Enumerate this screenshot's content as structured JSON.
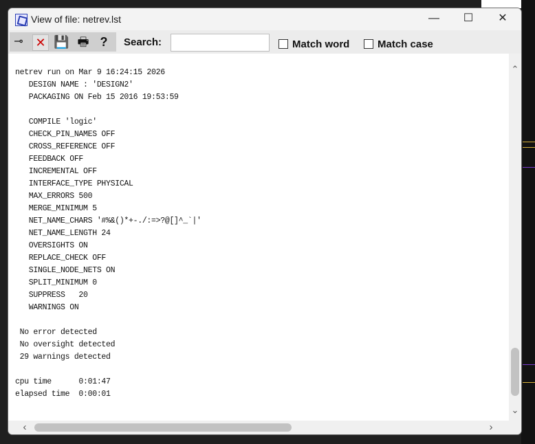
{
  "window": {
    "title": "View of file: netrev.lst",
    "controls": {
      "minimize": "—",
      "maximize": "☐",
      "close": "✕"
    }
  },
  "toolbar": {
    "tools": [
      {
        "name": "pin-tool",
        "glyph": "⊸"
      },
      {
        "name": "cancel-tool",
        "glyph": "✕"
      },
      {
        "name": "save-tool",
        "glyph": "💾"
      },
      {
        "name": "print-tool",
        "glyph": "🖶"
      },
      {
        "name": "help-tool",
        "glyph": "?"
      }
    ],
    "search_label": "Search:",
    "search_value": "",
    "match_word_label": "Match word",
    "match_word_checked": false,
    "match_case_label": "Match case",
    "match_case_checked": false
  },
  "file": {
    "lines": [
      "netrev run on Mar 9 16:24:15 2026",
      "   DESIGN NAME : 'DESIGN2'",
      "   PACKAGING ON Feb 15 2016 19:53:59",
      "",
      "   COMPILE 'logic'",
      "   CHECK_PIN_NAMES OFF",
      "   CROSS_REFERENCE OFF",
      "   FEEDBACK OFF",
      "   INCREMENTAL OFF",
      "   INTERFACE_TYPE PHYSICAL",
      "   MAX_ERRORS 500",
      "   MERGE_MINIMUM 5",
      "   NET_NAME_CHARS '#%&()*+-./:=>?@[]^_`|'",
      "   NET_NAME_LENGTH 24",
      "   OVERSIGHTS ON",
      "   REPLACE_CHECK OFF",
      "   SINGLE_NODE_NETS ON",
      "   SPLIT_MINIMUM 0",
      "   SUPPRESS   20",
      "   WARNINGS ON",
      "",
      " No error detected",
      " No oversight detected",
      " 29 warnings detected",
      "",
      "cpu time      0:01:47",
      "elapsed time  0:00:01"
    ]
  },
  "scrollbars": {
    "up": "⌃",
    "down": "⌄",
    "left": "‹",
    "right": "›"
  }
}
